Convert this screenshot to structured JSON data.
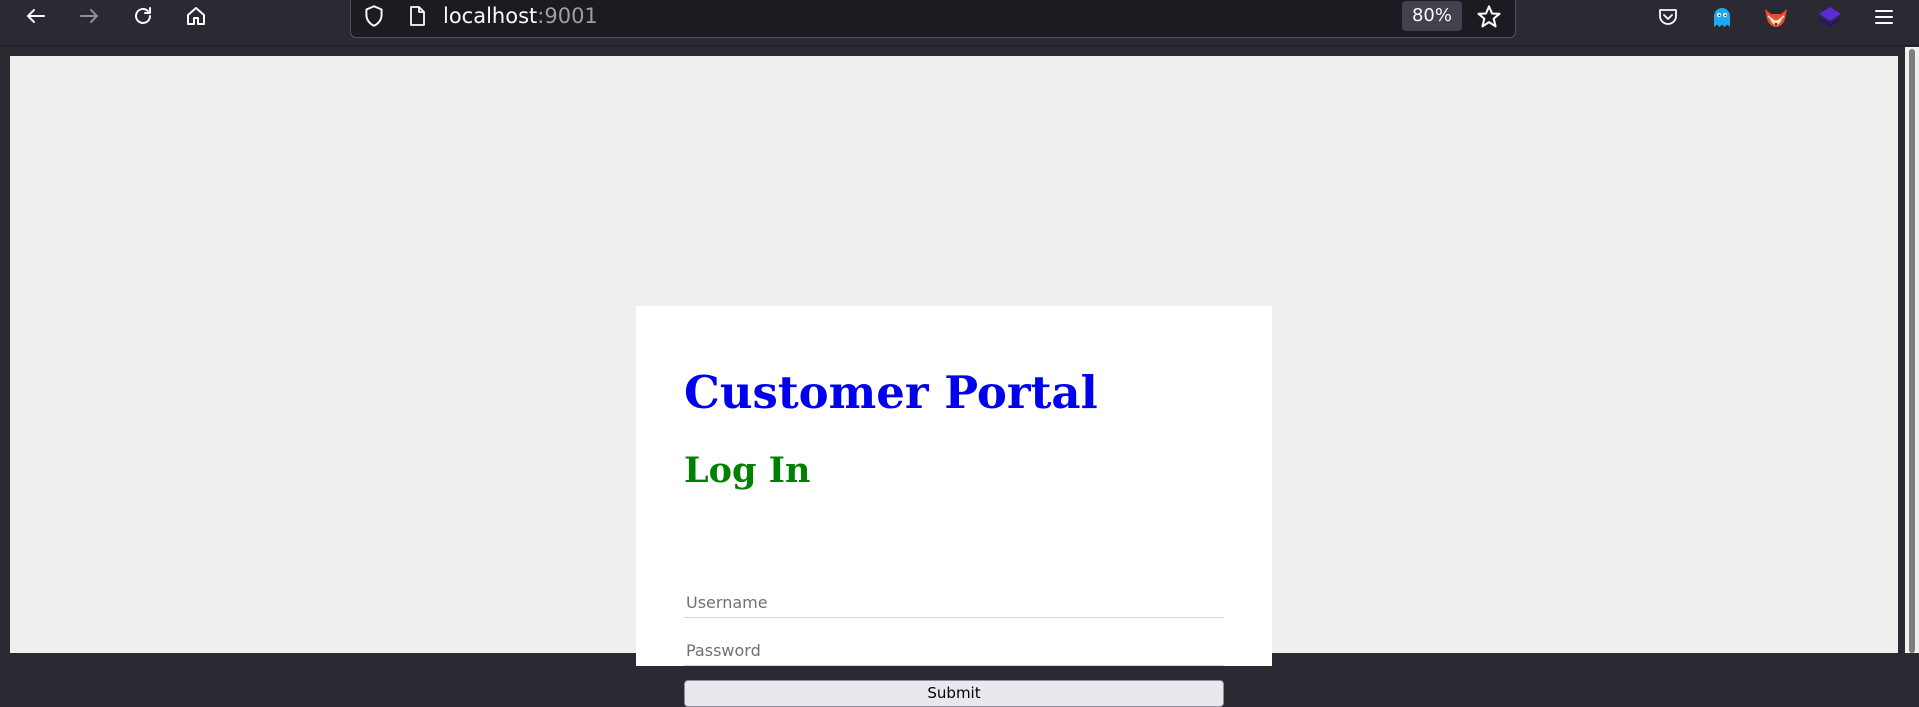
{
  "browser": {
    "url_host": "localhost",
    "url_port": ":9001",
    "zoom": "80%",
    "icons": {
      "back": "arrow-left-icon",
      "forward": "arrow-right-icon",
      "reload": "reload-icon",
      "home": "home-icon",
      "shield": "shield-icon",
      "page": "page-icon",
      "bookmark": "star-icon",
      "pocket": "pocket-icon",
      "ghost_ext": "ghost-icon",
      "fox_ext": "fox-icon",
      "stack_ext": "stack-icon",
      "menu": "hamburger-icon"
    }
  },
  "page": {
    "title": "Customer Portal",
    "subtitle": "Log In",
    "username_placeholder": "Username",
    "password_placeholder": "Password",
    "submit_label": "Submit"
  },
  "colors": {
    "title": "#0000ee",
    "subtitle": "#008000",
    "page_background": "#efefed",
    "card_background": "#ffffff",
    "toolbar": "#2b2a33"
  }
}
